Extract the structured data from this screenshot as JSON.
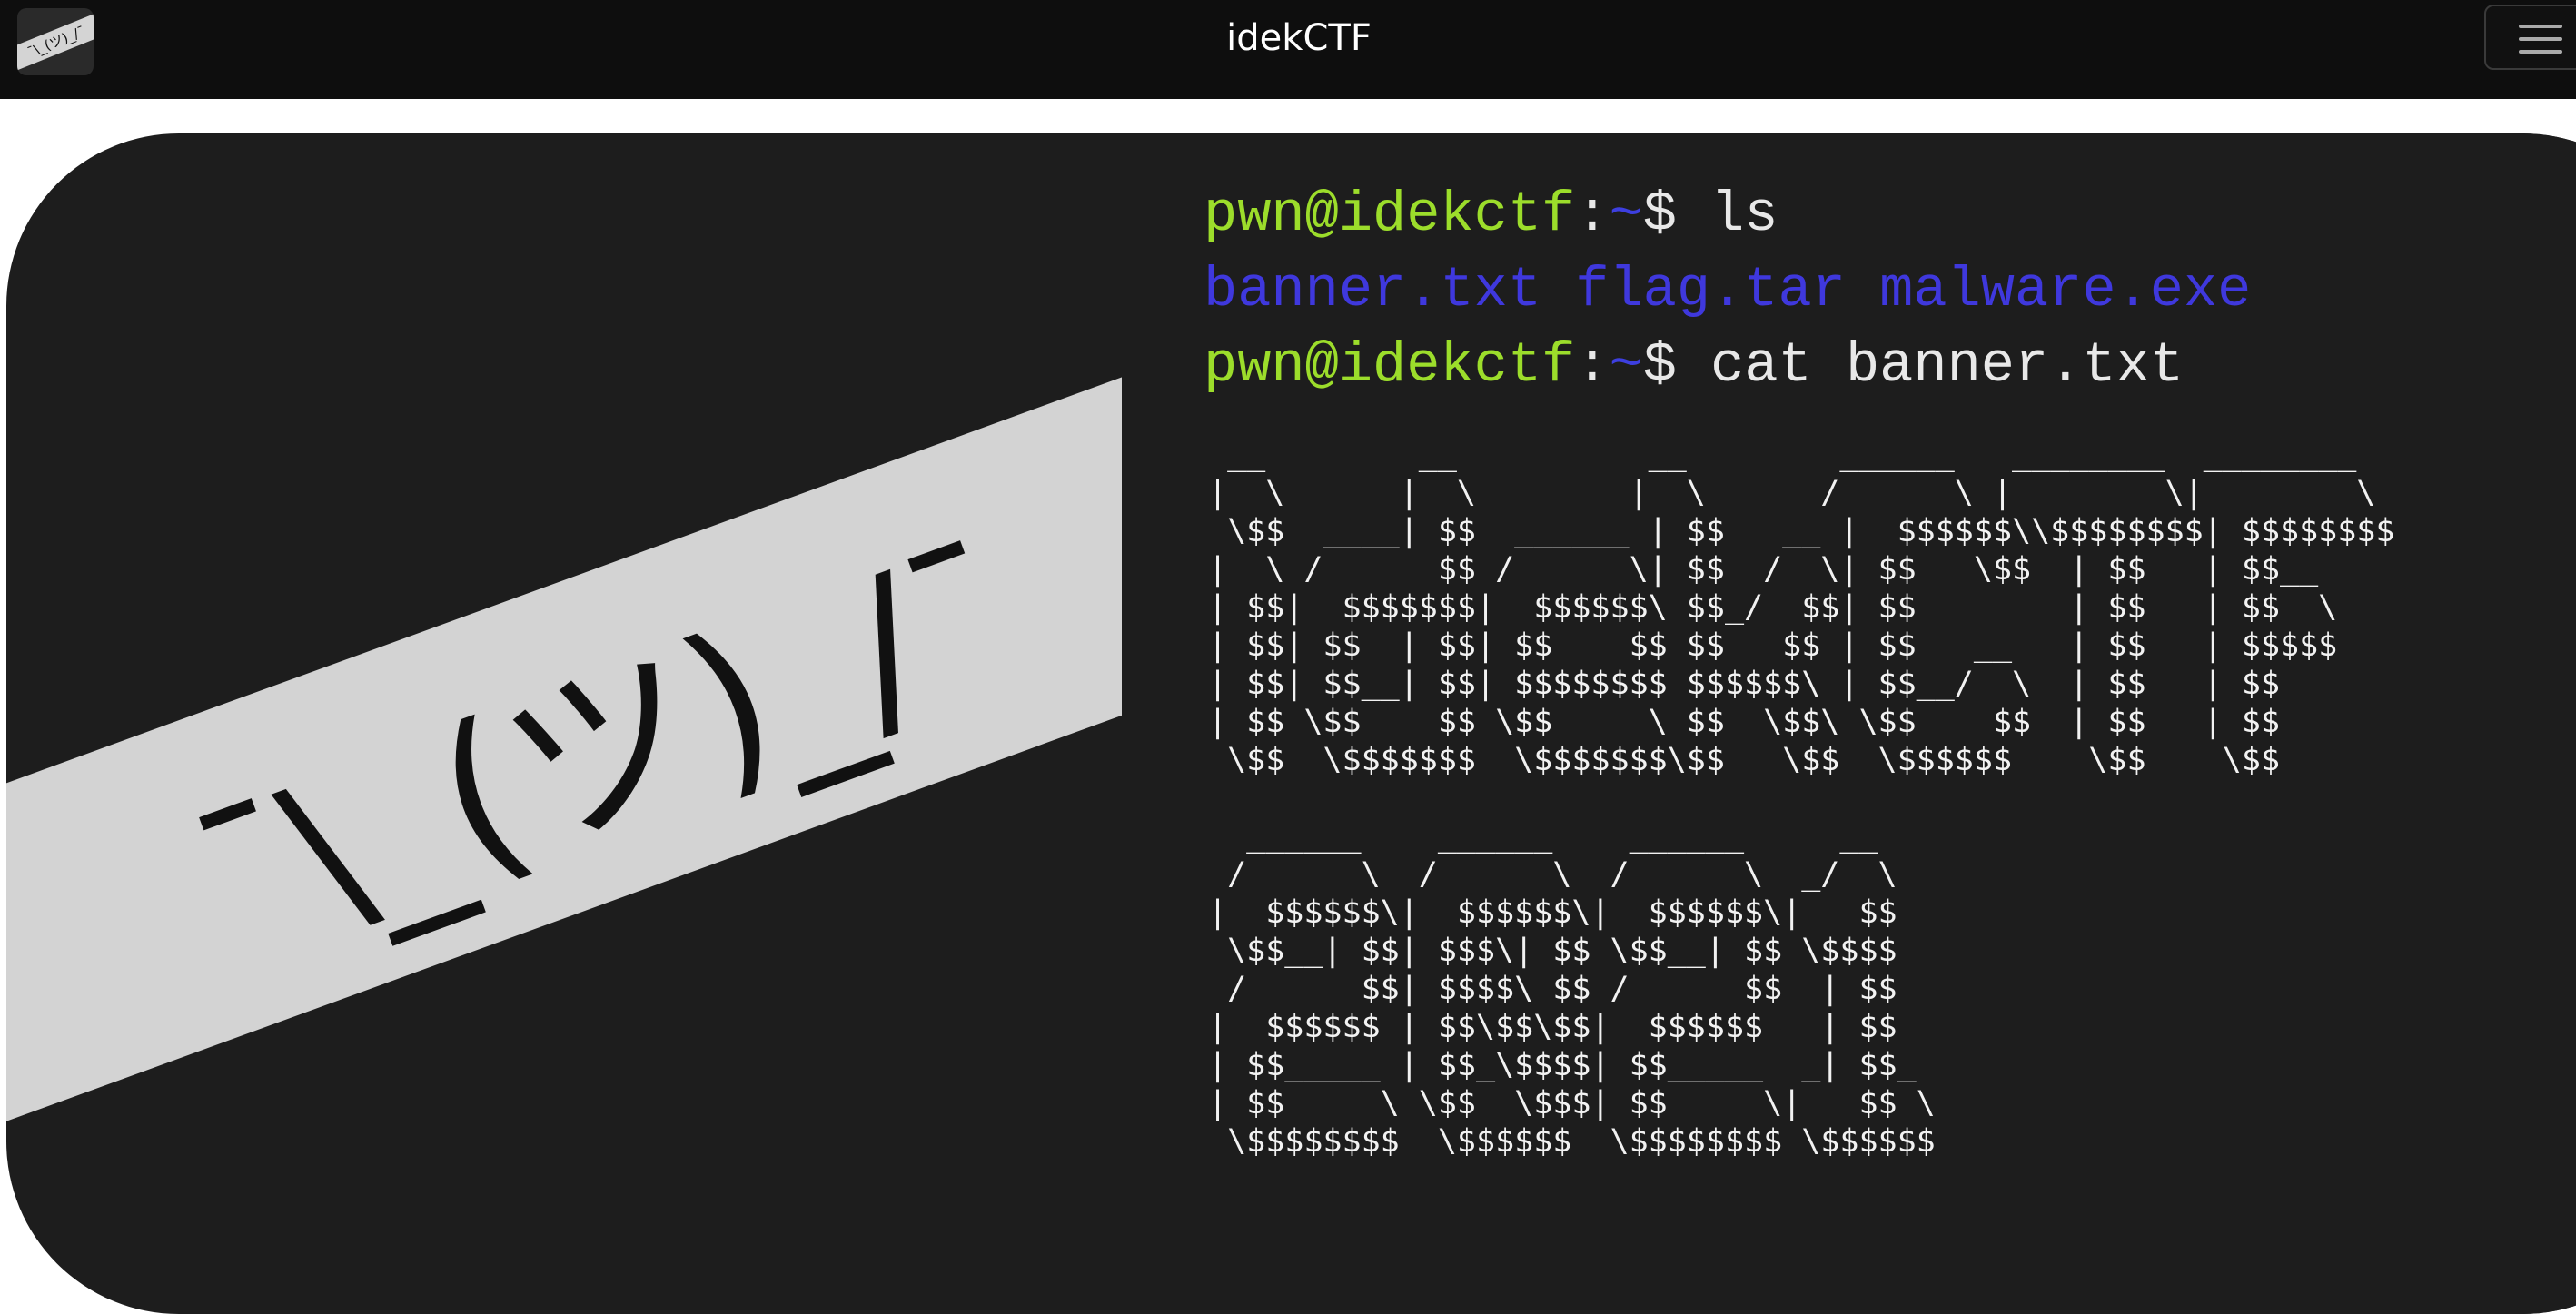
{
  "navbar": {
    "logo_text": "¯\\_(ツ)_/¯",
    "brand": "idekCTF",
    "menu_icon": "hamburger-menu-icon"
  },
  "hero": {
    "shrug": "¯\\_(ツ)_/¯",
    "terminal": {
      "line1_user": "pwn@idekctf",
      "line1_sep": ":",
      "line1_path": "~",
      "line1_sym": "$ ",
      "line1_cmd": "ls",
      "files": "banner.txt flag.tar malware.exe",
      "line2_user": "pwn@idekctf",
      "line2_sep": ":",
      "line2_path": "~",
      "line2_sym": "$ ",
      "line2_cmd": "cat banner.txt"
    },
    "banner_top": " __        __          __        ______   ________  ________ \n|  \\      |  \\        |  \\      /      \\ |        \\|        \\\n \\$$  ____| $$  ______ | $$   __ |  $$$$$$\\\\$$$$$$$$| $$$$$$$$\n|  \\ /      $$ /      \\| $$  /  \\| $$   \\$$  | $$   | $$__    \n| $$|  $$$$$$$|  $$$$$$\\ $$_/  $$| $$        | $$   | $$  \\   \n| $$| $$  | $$| $$    $$ $$   $$ | $$   __   | $$   | $$$$$   \n| $$| $$__| $$| $$$$$$$$ $$$$$$\\ | $$__/  \\  | $$   | $$      \n| $$ \\$$    $$ \\$$     \\ $$  \\$$\\ \\$$    $$  | $$   | $$      \n \\$$  \\$$$$$$$  \\$$$$$$$\\$$   \\$$  \\$$$$$$    \\$$    \\$$      ",
    "banner_bottom": "  ______    ______    ______     __   \n /      \\  /      \\  /      \\  _/  \\  \n|  $$$$$$\\|  $$$$$$\\|  $$$$$$\\|   $$  \n \\$$__| $$| $$$\\| $$ \\$$__| $$ \\$$$$  \n /      $$| $$$$\\ $$ /      $$  | $$  \n|  $$$$$$ | $$\\$$\\$$|  $$$$$$   | $$  \n| $$_____ | $$_\\$$$$| $$_____  _| $$_ \n| $$     \\ \\$$  \\$$$| $$     \\|   $$ \\\n \\$$$$$$$$  \\$$$$$$  \\$$$$$$$$ \\$$$$$$"
  },
  "colors": {
    "prompt_user": "#9cdd2b",
    "prompt_path": "#3d3fe0",
    "files": "#3f38dd",
    "hero_bg": "#1d1d1d",
    "band": "#d3d3d3"
  }
}
